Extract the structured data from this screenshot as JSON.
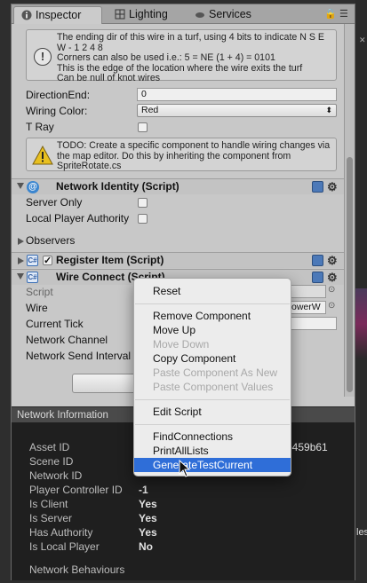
{
  "tabs": [
    {
      "label": "Inspector",
      "icon": "info-circle-icon"
    },
    {
      "label": "Lighting",
      "icon": "grid-icon"
    },
    {
      "label": "Services",
      "icon": "cloud-icon"
    }
  ],
  "tab_controls": {
    "lock_icon": "lock-icon",
    "menu_icon": "list-icon"
  },
  "help_top": "The ending dir of this wire in a turf, using 4 bits to indicate N S E W - 1 2 4 8\nCorners can also be used i.e.: 5 = NE (1 + 4) = 0101\nThis is the edge of the location where the wire exits the turf\nCan be null of knot wires",
  "fields": {
    "direction_end_label": "DirectionEnd:",
    "direction_end_value": "0",
    "wiring_color_label": "Wiring Color:",
    "wiring_color_value": "Red",
    "tray_label": "T Ray"
  },
  "help_todo": "TODO: Create a specific component to handle wiring changes via the map editor. Do this by inheriting the component from SpriteRotate.cs",
  "network_identity": {
    "title": "Network Identity (Script)",
    "server_only": "Server Only",
    "local_player_authority": "Local Player Authority",
    "observers": "Observers"
  },
  "register_item": {
    "title": "Register Item (Script)",
    "enabled": true
  },
  "wire_connect": {
    "title": "Wire Connect (Script)",
    "script_label": "Script",
    "wire_label": "Wire",
    "wire_value_partial": "owerW",
    "current_tick_label": "Current Tick",
    "network_channel_label": "Network Channel",
    "network_send_interval_label": "Network Send Interval"
  },
  "network_info": {
    "header": "Network Information",
    "rows": [
      {
        "label": "Asset ID",
        "value": ""
      },
      {
        "label": "Scene ID",
        "value": ""
      },
      {
        "label": "Network ID",
        "value": ""
      },
      {
        "label": "Player Controller ID",
        "value": "-1"
      },
      {
        "label": "Is Client",
        "value": "Yes"
      },
      {
        "label": "Is Server",
        "value": "Yes"
      },
      {
        "label": "Has Authority",
        "value": "Yes"
      },
      {
        "label": "Is Local Player",
        "value": "No"
      }
    ],
    "asset_id_tail": "b459b61",
    "behaviours_label": "Network Behaviours"
  },
  "context_menu": {
    "items": [
      {
        "label": "Reset",
        "disabled": false
      },
      {
        "label": "Remove Component",
        "disabled": false
      },
      {
        "label": "Move Up",
        "disabled": false
      },
      {
        "label": "Move Down",
        "disabled": true
      },
      {
        "label": "Copy Component",
        "disabled": false
      },
      {
        "label": "Paste Component As New",
        "disabled": true
      },
      {
        "label": "Paste Component Values",
        "disabled": true
      },
      {
        "label": "Edit Script",
        "disabled": false
      },
      {
        "label": "FindConnections",
        "disabled": false
      },
      {
        "label": "PrintAllLists",
        "disabled": false
      },
      {
        "label": "GenerateTestCurrent",
        "disabled": false,
        "selected": true
      }
    ]
  },
  "edge": {
    "text": "les"
  },
  "colors": {
    "menu_highlight": "#2f6ed8",
    "panel_bg": "#c8c8c8",
    "netinfo_bg": "#1f1f1f"
  }
}
